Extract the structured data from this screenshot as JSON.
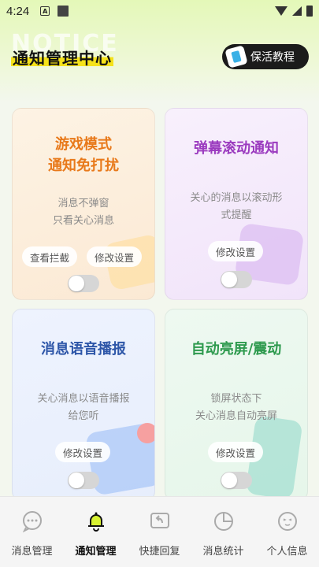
{
  "status_bar": {
    "time": "4:24",
    "app_letter": "A"
  },
  "header": {
    "bg_word": "NOTICE",
    "title": "通知管理中心",
    "tutorial_label": "保活教程"
  },
  "cards": [
    {
      "title_line1": "游戏模式",
      "title_line2": "通知免打扰",
      "desc_line1": "消息不弹窗",
      "desc_line2": "只看关心消息",
      "btn_intercept": "查看拦截",
      "btn_settings": "修改设置",
      "title_color": "#e8791a"
    },
    {
      "title_line1": "弹幕滚动通知",
      "desc_line1": "关心的消息以滚动形",
      "desc_line2": "式提醒",
      "btn_settings": "修改设置",
      "title_color": "#9b3bbf"
    },
    {
      "title_line1": "消息语音播报",
      "desc_line1": "关心消息以语音播报",
      "desc_line2": "给您听",
      "btn_settings": "修改设置",
      "title_color": "#2d56a8"
    },
    {
      "title_line1": "自动亮屏/震动",
      "desc_line1": "锁屏状态下",
      "desc_line2": "关心消息自动亮屏",
      "btn_settings": "修改设置",
      "title_color": "#2e9a4e"
    }
  ],
  "bottom_nav": [
    {
      "label": "消息管理",
      "icon": "chat-bubble-icon"
    },
    {
      "label": "通知管理",
      "icon": "bell-icon",
      "active": true
    },
    {
      "label": "快捷回复",
      "icon": "reply-icon"
    },
    {
      "label": "消息统计",
      "icon": "pie-chart-icon"
    },
    {
      "label": "个人信息",
      "icon": "person-face-icon"
    }
  ],
  "colors": {
    "accent_yellow": "#f5e21a",
    "active_bell": "#d8f231"
  }
}
